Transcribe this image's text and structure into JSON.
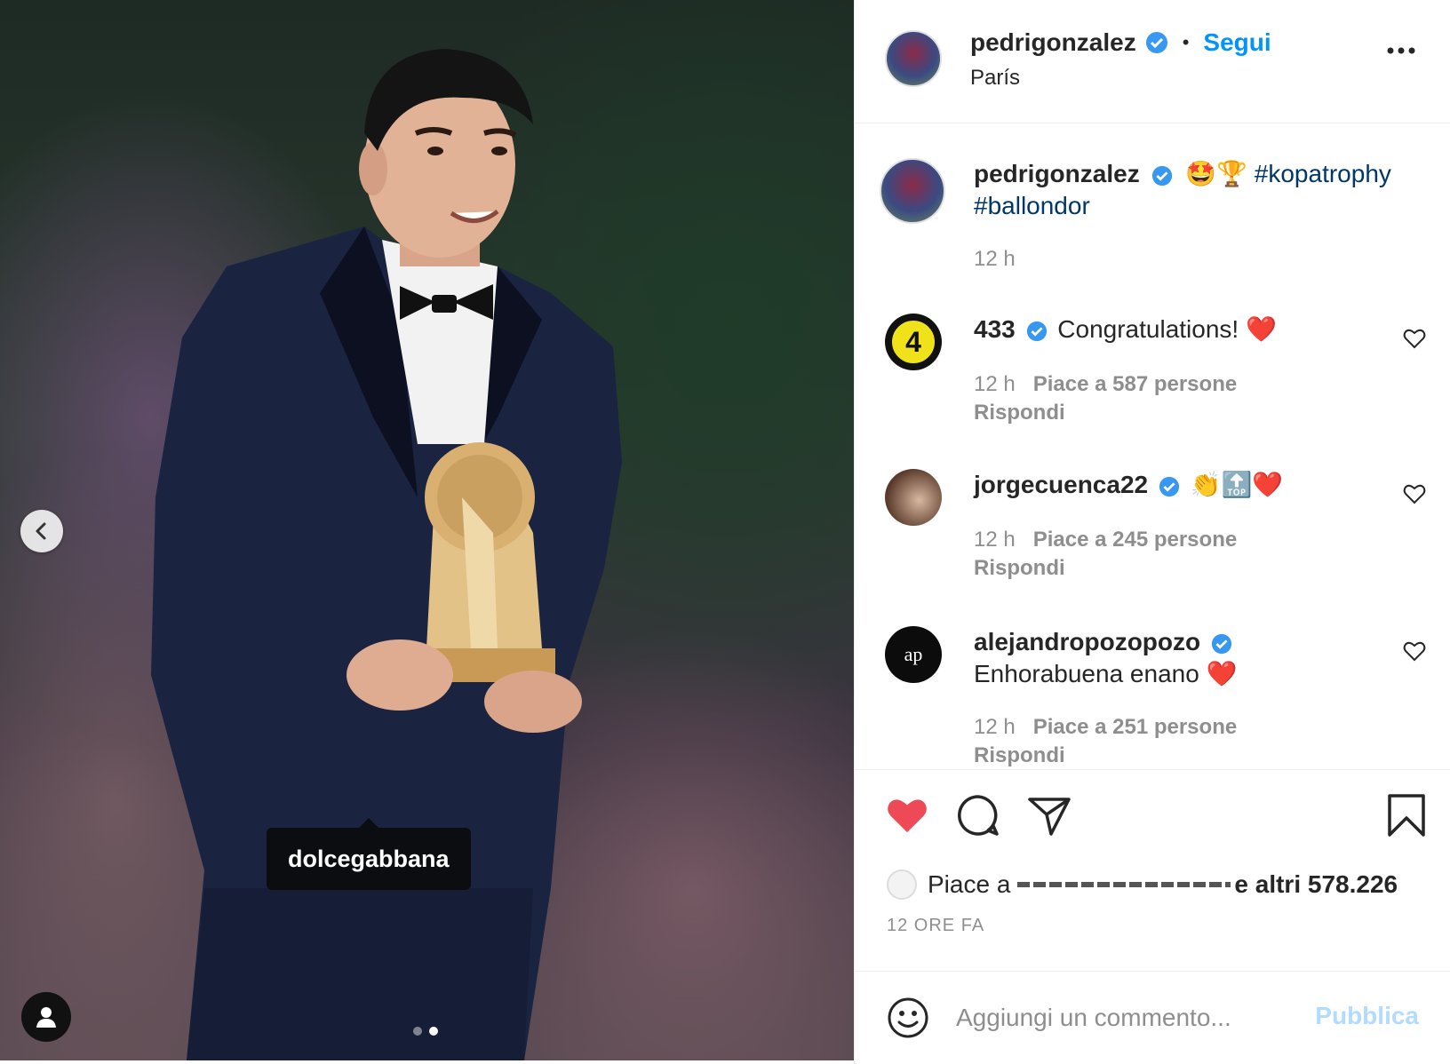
{
  "post": {
    "tag_label": "dolcegabbana",
    "carousel": {
      "count": 2,
      "active_index": 2
    }
  },
  "header": {
    "username": "pedrigonzalez",
    "separator": "•",
    "follow_label": "Segui",
    "location": "París"
  },
  "caption": {
    "username": "pedrigonzalez",
    "emoji": "🤩🏆",
    "hashtag1": "#kopatrophy",
    "hashtag2": "#ballondor",
    "time": "12 h"
  },
  "comments": [
    {
      "username": "433",
      "text": "Congratulations!",
      "emoji": "❤️",
      "time": "12 h",
      "likes": "Piace a 587 persone",
      "reply": "Rispondi",
      "avatar_label": "4"
    },
    {
      "username": "jorgecuenca22",
      "text": "",
      "emoji": "👏🔝❤️",
      "time": "12 h",
      "likes": "Piace a 245 persone",
      "reply": "Rispondi"
    },
    {
      "username": "alejandropozopozo",
      "text": "Enhorabuena enano",
      "emoji": "❤️",
      "time": "12 h",
      "likes": "Piace a 251 persone",
      "reply": "Rispondi",
      "avatar_label": "ap"
    }
  ],
  "likes_summary": {
    "prefix": "Piace a",
    "suffix": "e altri 578.226"
  },
  "time_ago": "12 ORE FA",
  "add_comment": {
    "placeholder": "Aggiungi un commento...",
    "publish_label": "Pubblica"
  },
  "colors": {
    "accent": "#0095f6",
    "like_red": "#ed4956",
    "hashtag": "#00376b",
    "muted": "#8e8e8e"
  },
  "icons": [
    "chevron-left-icon",
    "user-tag-icon",
    "verified-icon",
    "more-icon",
    "heart-icon",
    "comment-icon",
    "share-icon",
    "bookmark-icon",
    "emoji-icon"
  ]
}
